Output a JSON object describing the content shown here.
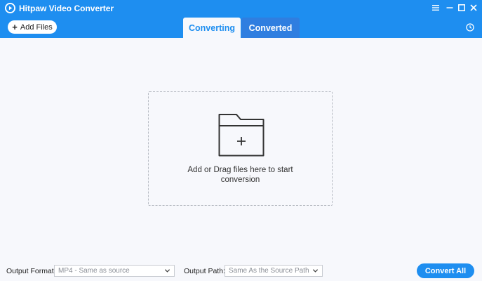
{
  "app": {
    "title": "Hitpaw Video Converter"
  },
  "toolbar": {
    "add_files_label": "Add Files",
    "tabs": [
      {
        "label": "Converting",
        "active": true
      },
      {
        "label": "Converted",
        "active": false
      }
    ]
  },
  "drop_zone": {
    "line1": "Add or Drag files here to start",
    "line2": "conversion"
  },
  "footer": {
    "output_format_label": "Output Format:",
    "output_format_value": "MP4 - Same as source",
    "output_path_label": "Output Path:",
    "output_path_value": "Same As the Source Path",
    "convert_all_label": "Convert All"
  },
  "icons": {
    "logo": "app-logo-icon",
    "menu": "hamburger-menu-icon",
    "minimize": "minimize-icon",
    "maximize": "maximize-icon",
    "close": "close-icon",
    "history": "history-clock-icon",
    "folder": "folder-add-icon",
    "dropdown": "chevron-down-icon"
  },
  "colors": {
    "accent": "#1e8ef0",
    "inactive_tab": "#2f7ee0",
    "background": "#f7f8fc"
  }
}
